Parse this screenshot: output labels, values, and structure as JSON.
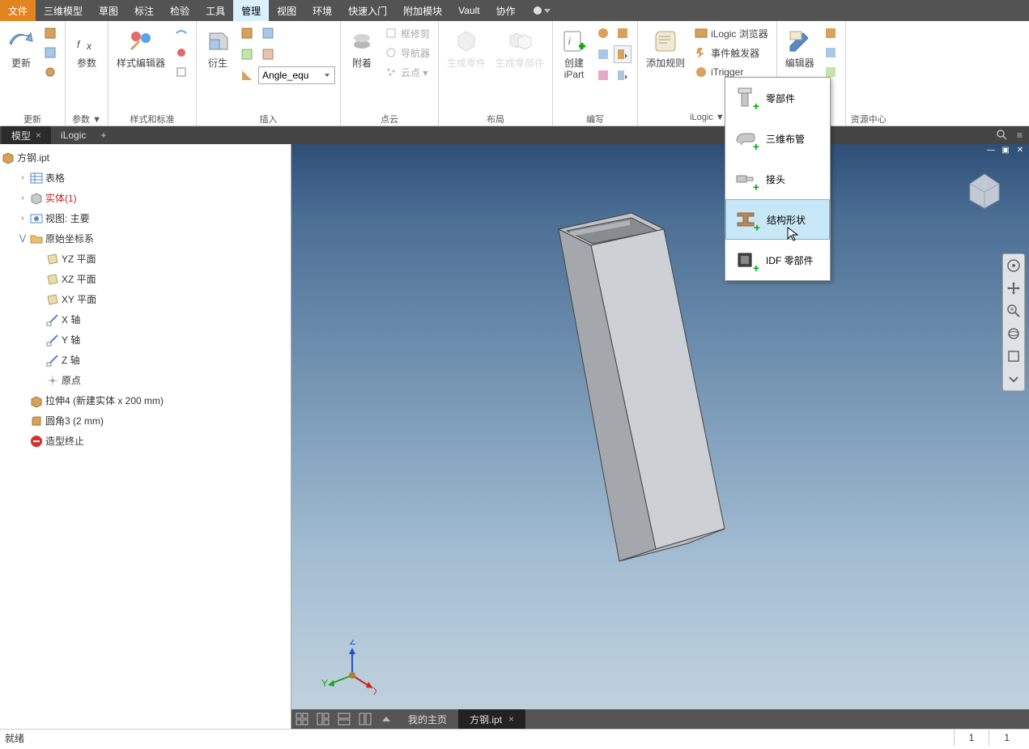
{
  "menu": {
    "file": "文件",
    "items": [
      "三维模型",
      "草图",
      "标注",
      "检验",
      "工具",
      "管理",
      "视图",
      "环境",
      "快速入门",
      "附加模块",
      "Vault",
      "协作"
    ],
    "active_index": 5
  },
  "ribbon": {
    "groups": [
      {
        "id": "update",
        "label": "更新",
        "big": {
          "label": "更新"
        }
      },
      {
        "id": "params",
        "label": "参数 ▼",
        "big": {
          "label": "参数"
        }
      },
      {
        "id": "style",
        "label": "样式和标准",
        "big": {
          "label": "样式编辑器"
        }
      },
      {
        "id": "insert",
        "label": "插入",
        "big": {
          "label": "衍生"
        },
        "combo": "Angle_equ"
      },
      {
        "id": "attach",
        "label": "点云",
        "big": {
          "label": "附着"
        },
        "rows": [
          "框修剪",
          "导航器",
          "云点 ▾"
        ]
      },
      {
        "id": "layout",
        "label": "布局",
        "btns": [
          "生成零件",
          "生成零部件"
        ]
      },
      {
        "id": "author",
        "label": "编写",
        "big": {
          "label": "创建\niPart"
        },
        "add_rule": "添加规则"
      },
      {
        "id": "ilogic",
        "label": "iLogic ▼",
        "rows": [
          "iLogic 浏览器",
          "事件触发器",
          "iTrigger"
        ]
      },
      {
        "id": "editor",
        "label": "",
        "big": {
          "label": "编辑器"
        }
      },
      {
        "id": "cc",
        "label": "资源中心"
      }
    ]
  },
  "popup": {
    "items": [
      "零部件",
      "三维布管",
      "接头",
      "结构形状",
      "IDF 零部件"
    ],
    "hover_index": 3
  },
  "panel_tabs": {
    "items": [
      "模型",
      "iLogic"
    ],
    "active": 0
  },
  "tree": {
    "root": "方钢.ipt",
    "nodes": [
      {
        "d": 1,
        "exp": ">",
        "ic": "table",
        "t": "表格"
      },
      {
        "d": 1,
        "exp": ">",
        "ic": "solid",
        "t": "实体(1)",
        "color": "#c22"
      },
      {
        "d": 1,
        "exp": ">",
        "ic": "view",
        "t": "视图: 主要"
      },
      {
        "d": 1,
        "exp": "v",
        "ic": "folder",
        "t": "原始坐标系"
      },
      {
        "d": 2,
        "exp": "",
        "ic": "plane",
        "t": "YZ 平面"
      },
      {
        "d": 2,
        "exp": "",
        "ic": "plane",
        "t": "XZ 平面"
      },
      {
        "d": 2,
        "exp": "",
        "ic": "plane",
        "t": "XY 平面"
      },
      {
        "d": 2,
        "exp": "",
        "ic": "axis",
        "t": "X 轴"
      },
      {
        "d": 2,
        "exp": "",
        "ic": "axis",
        "t": "Y 轴"
      },
      {
        "d": 2,
        "exp": "",
        "ic": "axis",
        "t": "Z 轴"
      },
      {
        "d": 2,
        "exp": "",
        "ic": "point",
        "t": "原点"
      },
      {
        "d": 1,
        "exp": "",
        "ic": "extrude",
        "t": "拉伸4 (新建实体 x 200 mm)"
      },
      {
        "d": 1,
        "exp": "",
        "ic": "fillet",
        "t": "圆角3 (2 mm)"
      },
      {
        "d": 1,
        "exp": "",
        "ic": "stop",
        "t": "造型终止"
      }
    ]
  },
  "doctabs": {
    "home": "我的主页",
    "items": [
      "方钢.ipt"
    ],
    "active": 0
  },
  "status": {
    "ready": "就绪",
    "cells": [
      "1",
      "1"
    ]
  },
  "triad": {
    "x": "Y",
    "y": "X",
    "z": "Z"
  }
}
